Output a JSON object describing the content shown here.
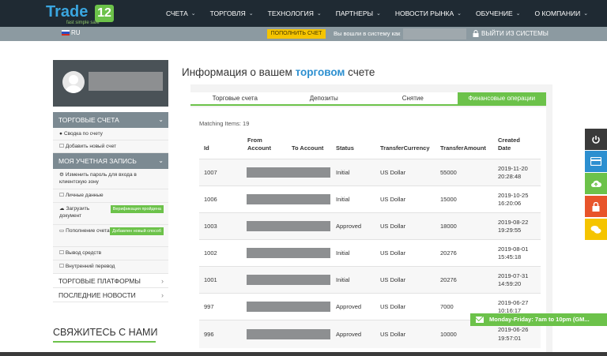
{
  "logo": {
    "word": "Trade",
    "badge": "12",
    "tagline": "fast simple safe"
  },
  "nav": [
    "СЧЕТА",
    "ТОРГОВЛЯ",
    "ТЕХНОЛОГИЯ",
    "ПАРТНЕРЫ",
    "НОВОСТИ РЫНКА",
    "ОБУЧЕНИЕ",
    "О КОМПАНИИ"
  ],
  "subbar": {
    "lang": "RU",
    "deposit_button": "ПОПОЛНИТЬ СЧЕТ",
    "logged_in_text": "Вы вошли в систему как",
    "logout": "ВЫЙТИ ИЗ СИСТЕМЫ"
  },
  "sidebar": {
    "trading_accounts": {
      "header": "ТОРГОВЫЕ СЧЕТА",
      "items": [
        "Сводка по счету",
        "Добавить новый счет"
      ]
    },
    "my_account": {
      "header": "МОЯ УЧЕТНАЯ ЗАПИСЬ",
      "items": [
        {
          "label": "Изменить пароль для входа в клиентскую зону",
          "badge": ""
        },
        {
          "label": "Личные данные",
          "badge": ""
        },
        {
          "label": "Загрузить документ",
          "badge": "Верификация пройдена"
        },
        {
          "label": "Пополнение счета",
          "badge": "Добавлен новый способ"
        },
        {
          "label": "Вывод средств",
          "badge": ""
        },
        {
          "label": "Внутренний перевод",
          "badge": ""
        }
      ]
    },
    "platforms": "ТОРГОВЫЕ ПЛАТФОРМЫ",
    "news": "ПОСЛЕДНИЕ НОВОСТИ",
    "contact": "СВЯЖИТЕСЬ С НАМИ"
  },
  "main": {
    "title_prefix": "Информация о вашем",
    "title_highlight": "торговом",
    "title_suffix": "счете",
    "tabs": [
      "Торговые счета",
      "Депозиты",
      "Снятие",
      "Финансовые операции"
    ],
    "active_tab": 3,
    "matching": "Matching Items: 19",
    "columns": {
      "id": "Id",
      "from1": "From",
      "from2": "Account",
      "to": "To Account",
      "status": "Status",
      "currency": "TransferCurrency",
      "amount": "TransferAmount",
      "created1": "Created",
      "created2": "Date"
    },
    "rows": [
      {
        "id": "1007",
        "status": "Initial",
        "currency": "US Dollar",
        "amount": "55000",
        "date": "2019-11-20",
        "time": "20:28:48"
      },
      {
        "id": "1006",
        "status": "Initial",
        "currency": "US Dollar",
        "amount": "15000",
        "date": "2019-10-25",
        "time": "16:20:06"
      },
      {
        "id": "1003",
        "status": "Approved",
        "currency": "US Dollar",
        "amount": "18000",
        "date": "2019-08-22",
        "time": "19:29:55"
      },
      {
        "id": "1002",
        "status": "Initial",
        "currency": "US Dollar",
        "amount": "20276",
        "date": "2019-08-01",
        "time": "15:45:18"
      },
      {
        "id": "1001",
        "status": "Initial",
        "currency": "US Dollar",
        "amount": "20276",
        "date": "2019-07-31",
        "time": "14:59:20"
      },
      {
        "id": "997",
        "status": "Approved",
        "currency": "US Dollar",
        "amount": "7000",
        "date": "2019-06-27",
        "time": "10:16:17"
      },
      {
        "id": "996",
        "status": "Approved",
        "currency": "US Dollar",
        "amount": "10000",
        "date": "2019-06-26",
        "time": "19:57:01"
      }
    ]
  },
  "float_buttons": [
    {
      "icon": "power-icon",
      "color": "#3a3a3a"
    },
    {
      "icon": "credit-card-icon",
      "color": "#2c8fd0"
    },
    {
      "icon": "cloud-upload-icon",
      "color": "#6cc24a"
    },
    {
      "icon": "lock-icon",
      "color": "#e8542a"
    },
    {
      "icon": "chat-icon",
      "color": "#f5c400"
    }
  ],
  "hours": "Monday-Friday: 7am to 10pm (GM...",
  "colors": {
    "green": "#6cc24a",
    "blue": "#2c8fd0",
    "dark": "#1f2a33",
    "grey_bar": "#8c9aa1"
  }
}
